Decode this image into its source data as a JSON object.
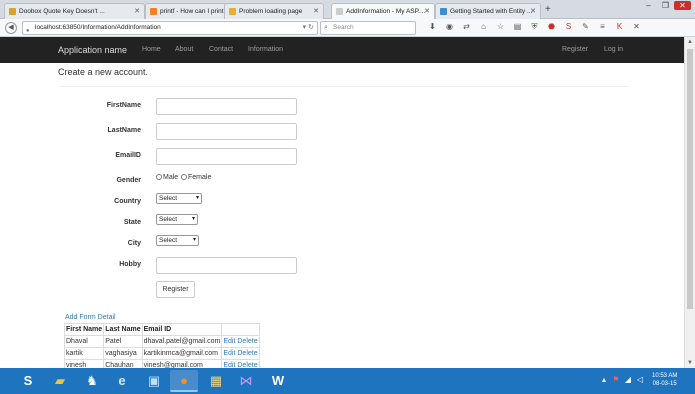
{
  "browser": {
    "tabs": [
      {
        "label": "Doobox Quote Key Doesn't ...",
        "icon": "doobox-icon",
        "color": "#d9a326",
        "active": false
      },
      {
        "label": "printf - How can I print a q...",
        "icon": "stackoverflow-icon",
        "color": "#f48024",
        "active": false
      },
      {
        "label": "Problem loading page",
        "icon": "warning-icon",
        "color": "#e8b02b",
        "active": false
      },
      {
        "label": "AddInformation - My ASP....",
        "icon": "page-icon",
        "color": "#cccccc",
        "active": true
      },
      {
        "label": "Getting Started with Entity ...",
        "icon": "microsoft-icon",
        "color": "#3e8ed0",
        "active": false
      }
    ],
    "new_tab": "+",
    "url": "localhost:63850/Information/AddInformation",
    "search_placeholder": "Search",
    "window_controls": {
      "minimize": "–",
      "maximize": "❐",
      "close": "✕"
    }
  },
  "app": {
    "brand": "Application name",
    "nav": [
      "Home",
      "About",
      "Contact",
      "Information"
    ],
    "nav_right": [
      "Register",
      "Log in"
    ]
  },
  "page": {
    "title": "Create a new account.",
    "fields": {
      "firstname_label": "FirstName",
      "lastname_label": "LastName",
      "email_label": "EmailID",
      "gender_label": "Gender",
      "gender_options": [
        "Male",
        "Female"
      ],
      "country_label": "Country",
      "country_value": "Select",
      "state_label": "State",
      "state_value": "Select",
      "city_label": "City",
      "city_value": "Select",
      "hobby_label": "Hobby"
    },
    "register_button": "Register",
    "add_form_detail": "Add Form Detail",
    "table": {
      "headers": [
        "First Name",
        "Last Name",
        "Email ID",
        ""
      ],
      "rows": [
        {
          "first": "Dhaval",
          "last": "Patel",
          "email": "dhaval.patel@gmail.com",
          "edit": "Edit",
          "delete": "Delete"
        },
        {
          "first": "kartik",
          "last": "vaghasiya",
          "email": "kartikinmca@gmail.com",
          "edit": "Edit",
          "delete": "Delete"
        },
        {
          "first": "vinesh",
          "last": "Chauhan",
          "email": "vinesh@gmail.com",
          "edit": "Edit",
          "delete": "Delete"
        }
      ]
    }
  },
  "taskbar": {
    "apps": [
      "skype-icon",
      "folder-icon",
      "elephant-icon",
      "internet-explorer-icon",
      "firefox-icon",
      "file-explorer-icon",
      "visual-studio-icon",
      "word-icon"
    ],
    "time": "10:53 AM",
    "date": "08-03-15"
  },
  "colors": {
    "app_header_bg": "#222222",
    "link": "#337ab7",
    "taskbar_bg": "#1f74c0"
  }
}
